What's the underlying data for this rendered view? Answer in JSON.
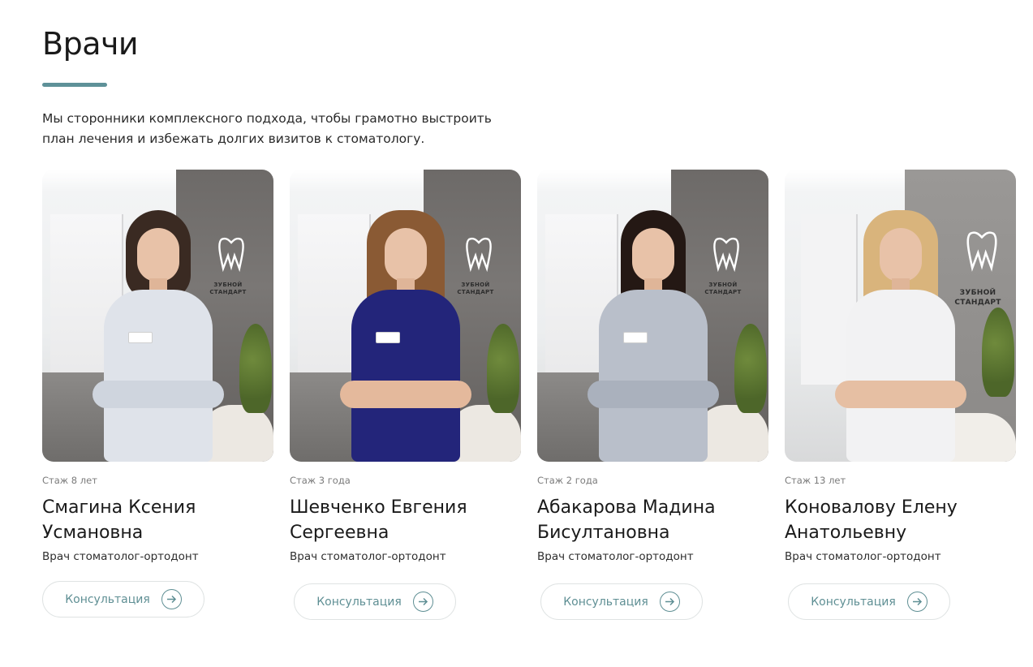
{
  "section": {
    "title": "Врачи",
    "intro": "Мы сторонники комплексного подхода, чтобы грамотно выстроить план лечения и избежать долгих визитов к стоматологу."
  },
  "colors": {
    "accent": "#5e9198",
    "button_text": "#5f8f94",
    "button_border": "#dfe3e3"
  },
  "doctors": [
    {
      "experience": "Стаж 8 лет",
      "name": "Смагина Ксения Усмановна",
      "role": "Врач стоматолог-ортодонт",
      "button_label": "Консультация",
      "button_icon": "arrow-right-circle-icon"
    },
    {
      "experience": "Стаж 3 года",
      "name": "Шевченко Евгения Сергеевна",
      "role": "Врач стоматолог-ортодонт",
      "button_label": "Консультация",
      "button_icon": "arrow-right-circle-icon"
    },
    {
      "experience": "Стаж 2 года",
      "name": "Абакарова Мадина Бисултановна",
      "role": "Врач стоматолог-ортодонт",
      "button_label": "Консультация",
      "button_icon": "arrow-right-circle-icon"
    },
    {
      "experience": "Стаж 13 лет",
      "name": "Коновалову Елену Анатольевну",
      "role": "Врач стоматолог-ортодонт",
      "button_label": "Консультация",
      "button_icon": "arrow-right-circle-icon"
    }
  ],
  "clinic_logo": {
    "text": "ЗУБНОЙ СТАНДАРТ",
    "icon": "tooth-logo-icon"
  }
}
